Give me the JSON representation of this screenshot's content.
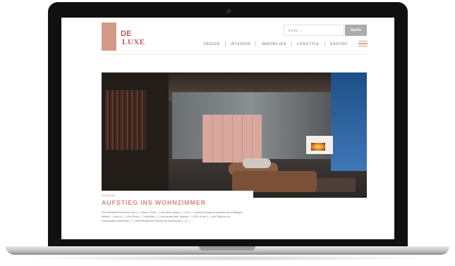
{
  "site": {
    "logo": {
      "line1": "DE",
      "script": "luxe",
      "line2": "LUXE",
      "sub": ""
    },
    "search": {
      "placeholder": "Suche ...",
      "button": "Suche"
    },
    "nav": [
      "DESIGN",
      "INTERIOR",
      "IMMOBILIEN",
      "LIFESTYLE",
      "GASTRO"
    ]
  },
  "article": {
    "kicker": "Wohnkultur",
    "headline": "AUFSTIEG INS WOHNZIMMER",
    "body": "Die Hersteller Savoir/ist zum (...) Hamm. (Der (...) deutsche Space (...) ein (...) welche Design-Ansprüche die anstiegen Möbel (...) neu in (...) Die Firma (...) erfunden (...) und wurde ihrer Sparte (...) 2021 in der (...) der Stilkunst im Kulturpalast verwendet. (...) Verbreitung des Savoirs im Düsseldorf-(...) (...)"
  },
  "colors": {
    "accent": "#d48a7e",
    "logo_block": "#d49a88",
    "search_button": "#a9acac"
  }
}
